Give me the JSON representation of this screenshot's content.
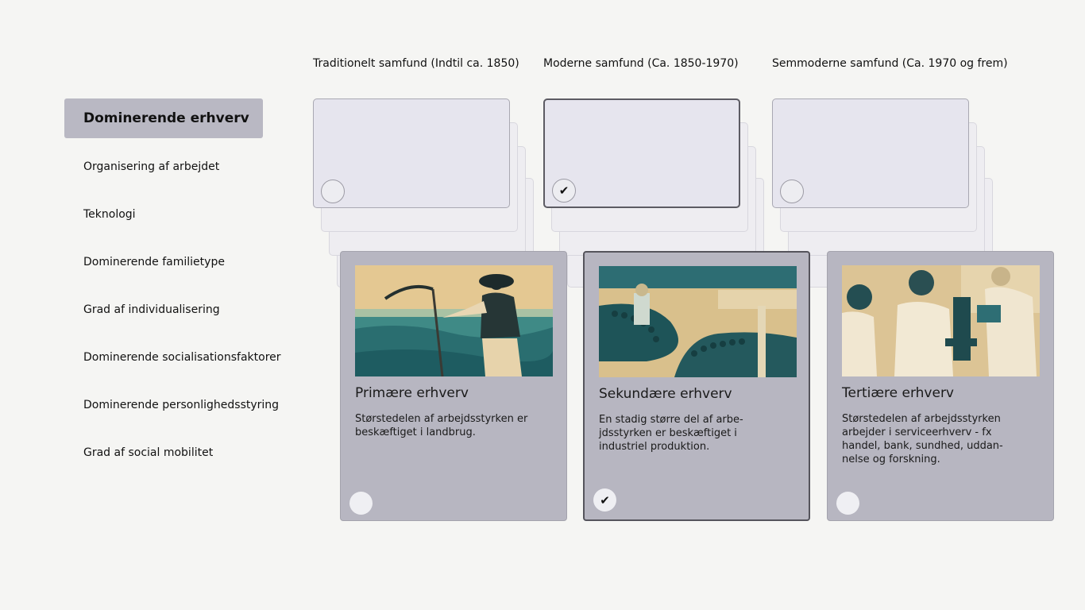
{
  "columns": [
    {
      "header": "Traditionelt samfund (Indtil ca. 1850)"
    },
    {
      "header": "Moderne samfund (Ca. 1850-1970)"
    },
    {
      "header": "Semmoderne samfund (Ca. 1970 og frem)"
    }
  ],
  "sidebar": {
    "active": "Dominerende erhverv",
    "items": [
      "Organisering af arbejdet",
      "Teknologi",
      "Dominerende familietype",
      "Grad af individualisering",
      "Dominerende socialisationsfaktorer",
      "Dominerende personlighedsstyring",
      "Grad af social mobilitet"
    ]
  },
  "check_glyph": "✔",
  "cards": [
    {
      "title": "Primære erhverv",
      "desc": "Størstedelen af arbejdsstyrken er beskæftiget i landbrug.",
      "image_icon": "farmer-with-scythe-photo",
      "selected": false
    },
    {
      "title": "Sekundære erhverv",
      "desc": "En stadig større del af arbe-jdsstyrken er beskæftiget i industriel produktion.",
      "image_icon": "factory-bottle-line-photo",
      "selected": true
    },
    {
      "title": "Tertiære erhverv",
      "desc": "Størstedelen af arbejdsstyrken arbejder i serviceerhverv - fx handel, bank, sundhed, uddan-nelse og forskning.",
      "image_icon": "laboratory-scientists-photo",
      "selected": false
    }
  ],
  "colors": {
    "background": "#f5f5f3",
    "card": "#b7b6c1",
    "photo_dark": "#1f6b73",
    "photo_light": "#e3c68f"
  }
}
